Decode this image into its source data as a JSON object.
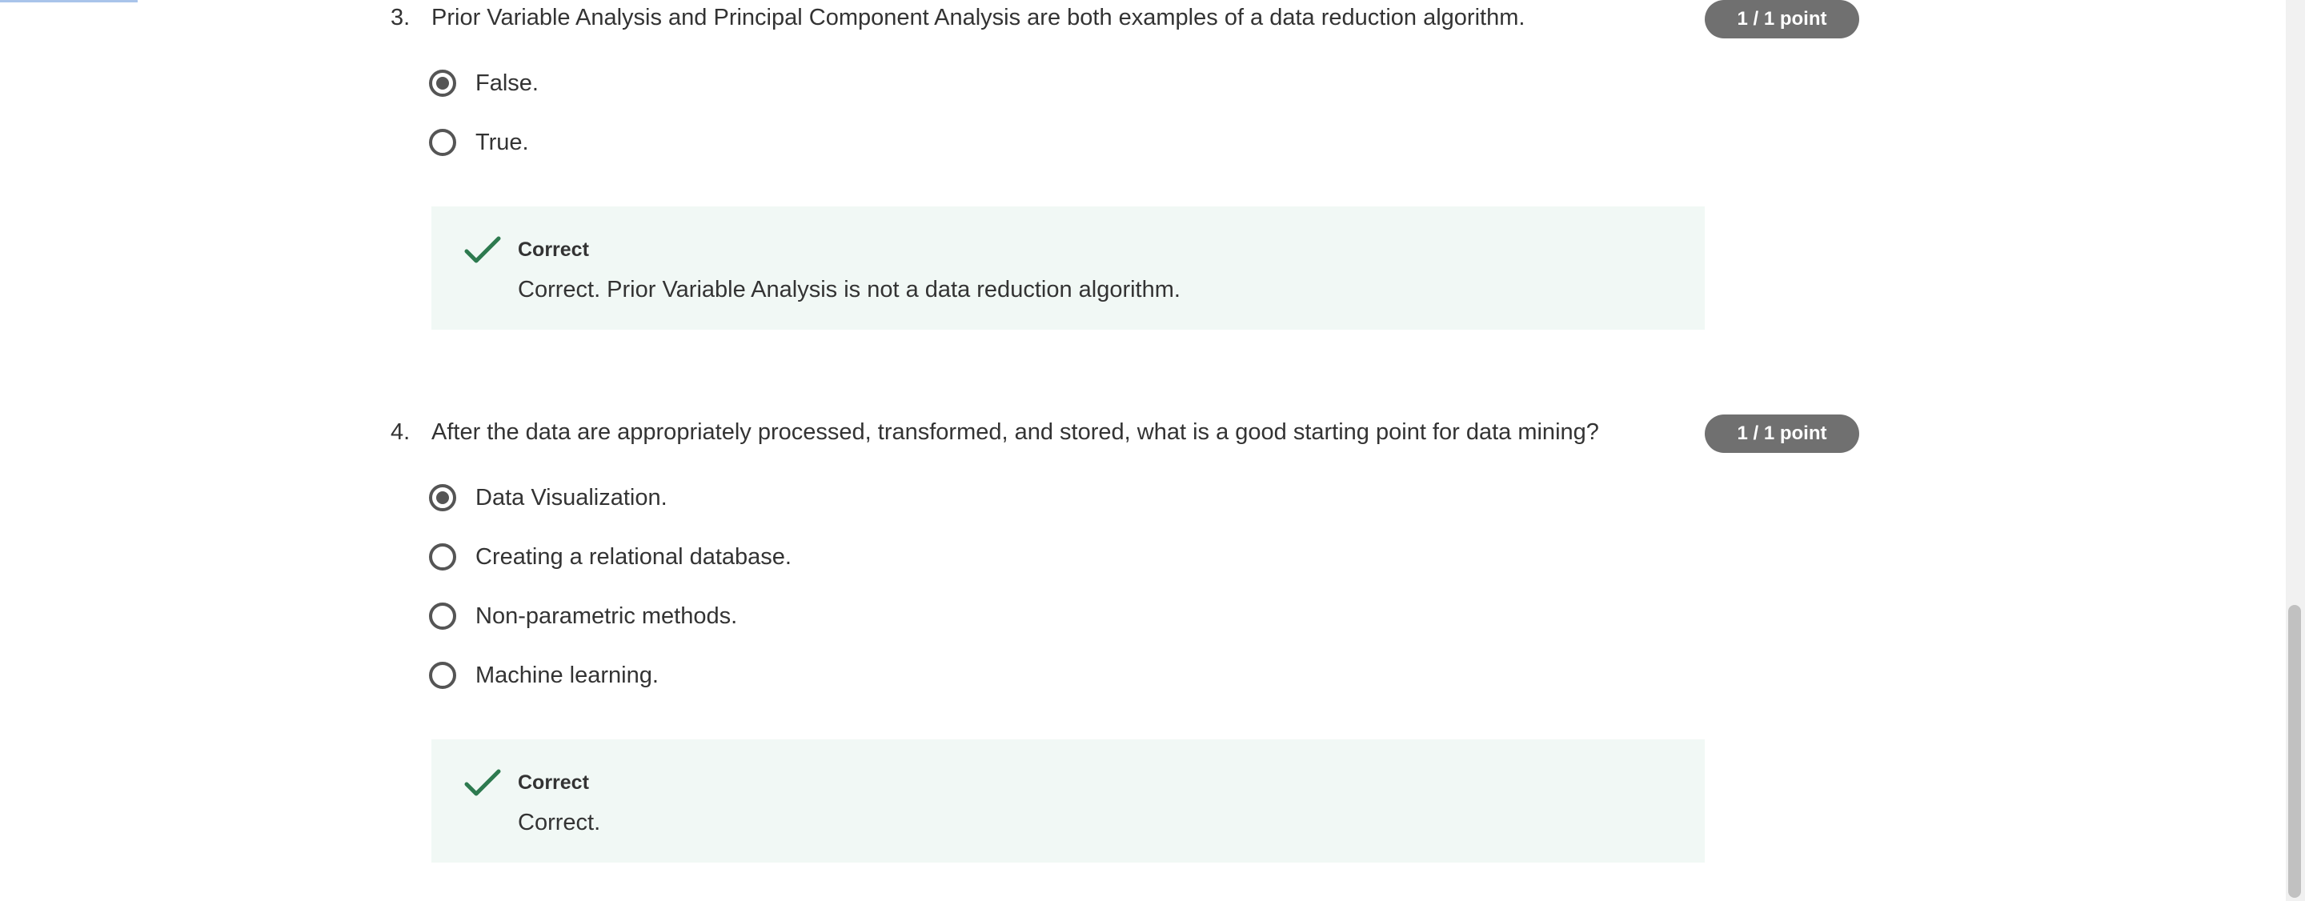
{
  "questions": [
    {
      "number": "3.",
      "text": "Prior Variable Analysis and Principal Component Analysis are both examples of a data reduction algorithm.",
      "points": "1 / 1 point",
      "options": [
        {
          "label": "False.",
          "selected": true
        },
        {
          "label": "True.",
          "selected": false
        }
      ],
      "feedback": {
        "title": "Correct",
        "text": "Correct. Prior Variable Analysis is not a data reduction algorithm."
      }
    },
    {
      "number": "4.",
      "text": "After the data are appropriately processed, transformed, and stored, what is a good starting point for data mining?",
      "points": "1 / 1 point",
      "options": [
        {
          "label": "Data Visualization.",
          "selected": true
        },
        {
          "label": "Creating a relational database.",
          "selected": false
        },
        {
          "label": "Non-parametric methods.",
          "selected": false
        },
        {
          "label": "Machine learning.",
          "selected": false
        }
      ],
      "feedback": {
        "title": "Correct",
        "text": "Correct."
      }
    }
  ],
  "icons": {
    "check": "checkmark-icon",
    "radio_selected": "radio-selected-icon",
    "radio_unselected": "radio-unselected-icon"
  },
  "colors": {
    "badge_background": "#707070",
    "feedback_background": "#f1f8f5",
    "check_green": "#2d7a4f",
    "text": "#333333",
    "radio_border": "#555555"
  }
}
